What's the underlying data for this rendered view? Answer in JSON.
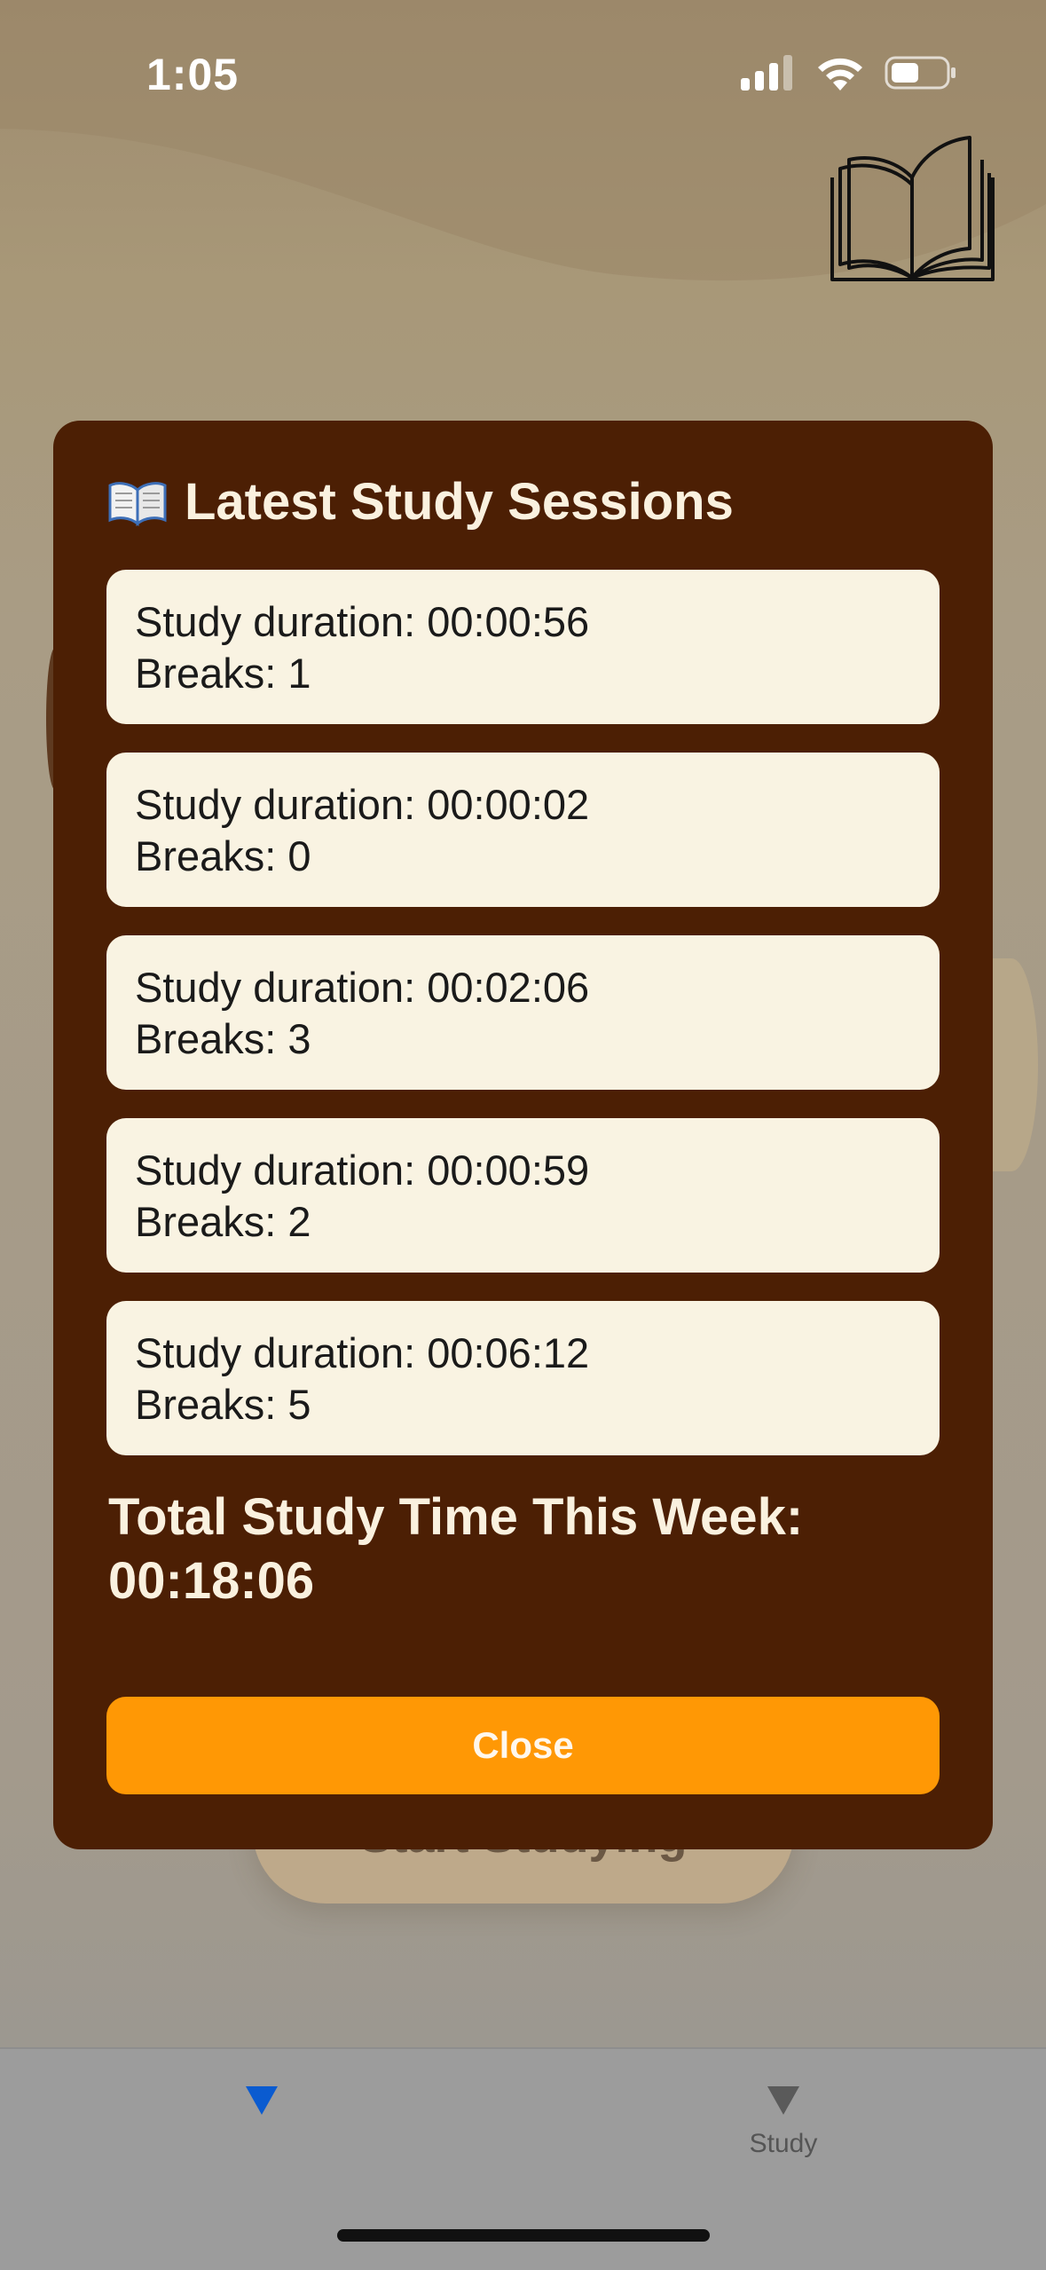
{
  "status_bar": {
    "time": "1:05"
  },
  "background": {
    "start_button_label": "Start Studying"
  },
  "modal": {
    "title_emoji": "📖",
    "title": "Latest Study Sessions",
    "sessions": [
      {
        "duration": "Study duration: 00:00:56",
        "breaks": "Breaks: 1"
      },
      {
        "duration": "Study duration: 00:00:02",
        "breaks": "Breaks: 0"
      },
      {
        "duration": "Study duration: 00:02:06",
        "breaks": "Breaks: 3"
      },
      {
        "duration": "Study duration: 00:00:59",
        "breaks": "Breaks: 2"
      },
      {
        "duration": "Study duration: 00:06:12",
        "breaks": "Breaks: 5"
      }
    ],
    "total_label": "Total Study Time This Week:",
    "total_value": "00:18:06",
    "close_label": "Close"
  },
  "tabs": [
    {
      "label": "",
      "icon": "triangle-down-icon",
      "active": true
    },
    {
      "label": "Study",
      "icon": "triangle-down-icon",
      "active": false
    }
  ],
  "colors": {
    "modal_bg": "#4c1f04",
    "card_bg": "#f9f3e2",
    "close_button": "#ff9805",
    "active_tab": "#0a5bd0",
    "inactive_tab": "#5a5a5a"
  }
}
